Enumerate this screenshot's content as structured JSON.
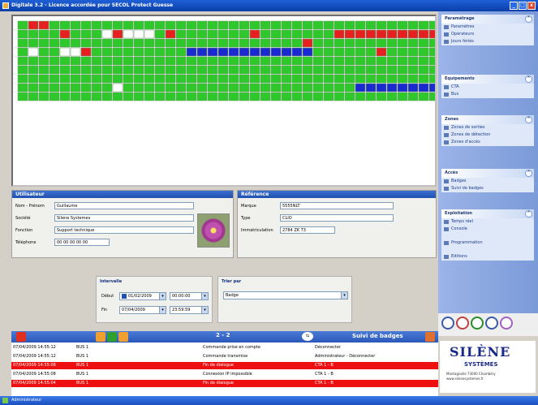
{
  "window": {
    "title": "Digitale 3.2 - Licence accordée pour SECOL Protect Guesse",
    "buttons": [
      "_",
      "□",
      "x"
    ]
  },
  "seat_grid": {
    "rows": 9,
    "cols": 42,
    "colors": {
      "free": "#2ec82a",
      "blocked": "#e62020",
      "reserved": "#1a2ad0",
      "unavailable": "#ffffff"
    }
  },
  "user_panel": {
    "title": "Utilisateur",
    "fields": [
      {
        "label": "Nom - Prénom",
        "value": "Guillaume"
      },
      {
        "label": "Société",
        "value": "Silene Systemes"
      },
      {
        "label": "Fonction",
        "value": "Support technique"
      },
      {
        "label": "Téléphone",
        "value": "00 00 00 00 00"
      }
    ]
  },
  "reference_panel": {
    "title": "Référence",
    "fields": [
      {
        "label": "Marque",
        "value": "5555NLT"
      },
      {
        "label": "Type",
        "value": "CLIO"
      },
      {
        "label": "Immatriculation",
        "value": "2784 ZK 73"
      }
    ]
  },
  "interval": {
    "title": "Intervalle",
    "debut_label": "Début",
    "fin_label": "Fin",
    "debut_date": "01/02/2009",
    "debut_time": "00:00:00",
    "fin_date": "07/04/2009",
    "fin_time": "23:59:59"
  },
  "sort": {
    "title": "Trier par",
    "value": "Badge"
  },
  "sidebar": {
    "groups": [
      {
        "title": "Paramétrage",
        "items": [
          "Paramètres",
          "Opérateurs",
          "Jours fériés"
        ]
      },
      {
        "title": "Equipements",
        "items": [
          "CTA",
          "Bus"
        ]
      },
      {
        "title": "Zones",
        "items": [
          "Zones de sorties",
          "Zones de détection",
          "Zones d'accès"
        ]
      },
      {
        "title": "Accès",
        "items": [
          "Badges",
          "Suivi de badges"
        ]
      },
      {
        "title": "Exploitation",
        "items": [
          "Temps réel",
          "Console",
          "Programmation",
          "Editions"
        ]
      }
    ]
  },
  "status_strip": {
    "counter": "2 - 2",
    "section": "Suivi de badges"
  },
  "log": {
    "rows": [
      {
        "date": "07/04/2009 14:55:12",
        "device": "BUS 1",
        "event": "Commande prise en compte",
        "detail": "Déconnecter",
        "alarm": false
      },
      {
        "date": "07/04/2009 14:55:12",
        "device": "BUS 1",
        "event": "Commande transmise",
        "detail": "Administrateur - Déconnecter",
        "alarm": false
      },
      {
        "date": "07/04/2009 14:55:08",
        "device": "BUS 1",
        "event": "Fin de dialogue",
        "detail": "CTA 1 - B",
        "alarm": true
      },
      {
        "date": "07/04/2009 14:55:08",
        "device": "BUS 1",
        "event": "Connexion IP impossible",
        "detail": "CTA 1 - B",
        "alarm": false
      },
      {
        "date": "07/04/2009 14:55:04",
        "device": "BUS 1",
        "event": "Fin de dialogue",
        "detail": "CTA 1 - B",
        "alarm": true
      }
    ]
  },
  "logo": {
    "brand": "SILÈNE",
    "sub": "SYSTÈMES",
    "address": "Montagnolle 73000 Chambéry",
    "website": "www.silenesystemes.fr"
  },
  "taskbar": {
    "user": "Administrateur"
  }
}
